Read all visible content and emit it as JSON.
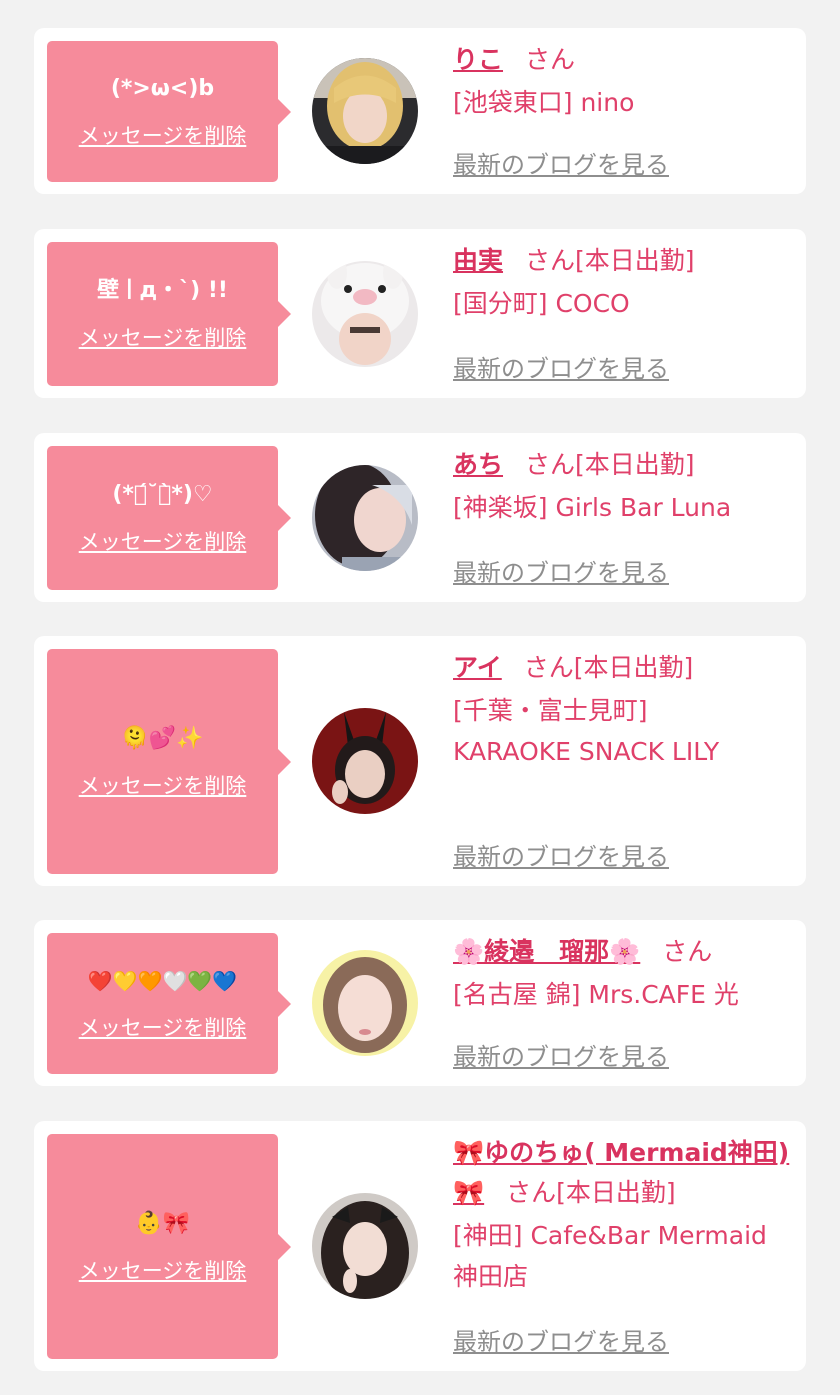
{
  "favorites": [
    {
      "message": "(*>ω<)b",
      "delete_label": "メッセージを削除",
      "name": "りこ",
      "honorific": "さん",
      "status": "",
      "shop": "[池袋東口] nino",
      "blog_label": "最新のブログを見る"
    },
    {
      "message": "壁ㅣд・`) !!",
      "delete_label": "メッセージを削除",
      "name": "由実",
      "honorific": "さん",
      "status": "[本日出勤]",
      "shop": "[国分町] COCO",
      "blog_label": "最新のブログを見る"
    },
    {
      "message": "(*ฅ́˘ฅ̀*)♡",
      "delete_label": "メッセージを削除",
      "name": "あち",
      "honorific": "さん",
      "status": "[本日出勤]",
      "shop": "[神楽坂] Girls Bar Luna",
      "blog_label": "最新のブログを見る"
    },
    {
      "message": "🫠💕✨",
      "delete_label": "メッセージを削除",
      "name": "アイ",
      "honorific": "さん",
      "status": "[本日出勤]",
      "shop": "[千葉・富士見町] KARAOKE SNACK LILY",
      "blog_label": "最新のブログを見る"
    },
    {
      "message": "❤️💛🧡🤍💚💙",
      "delete_label": "メッセージを削除",
      "name": "🌸綾邉　瑠那🌸",
      "honorific": "さん",
      "status": "",
      "shop": "[名古屋 錦] Mrs.CAFE 光",
      "blog_label": "最新のブログを見る"
    },
    {
      "message": "👶🎀",
      "delete_label": "メッセージを削除",
      "name": "🎀ゆのちゅ( Mermaid神田)🎀",
      "honorific": "さん",
      "status": "[本日出勤]",
      "shop": "[神田] Cafe&Bar Mermaid 神田店",
      "blog_label": "最新のブログを見る"
    }
  ],
  "colors": {
    "page_bg": "#f2f2f2",
    "bubble": "#f68b9b",
    "name": "#d9335f",
    "shop_text": "#e0406a",
    "blog_link": "#8e8e8e"
  }
}
